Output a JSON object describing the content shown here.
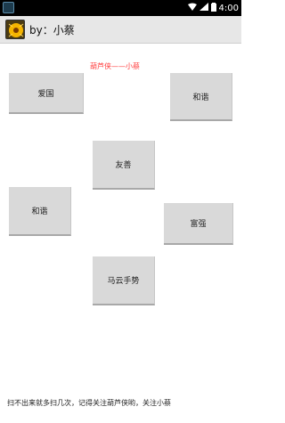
{
  "status_bar": {
    "time": "4:00"
  },
  "app_bar": {
    "title": "by：小蔡"
  },
  "subtitle": "葫芦侠——小蔡",
  "buttons": {
    "b1": "爱国",
    "b2": "和谐",
    "b3": "友善",
    "b4": "和谐",
    "b5": "富强",
    "b6": "马云手势"
  },
  "footer": "扫不出来就多扫几次，记得关注葫芦侠哟，关注小蔡",
  "colors": {
    "subtitle": "#ff3b3b",
    "button_bg": "#d9d9d9",
    "app_bar_bg": "#e7e7e7",
    "status_bar_bg": "#000000"
  }
}
